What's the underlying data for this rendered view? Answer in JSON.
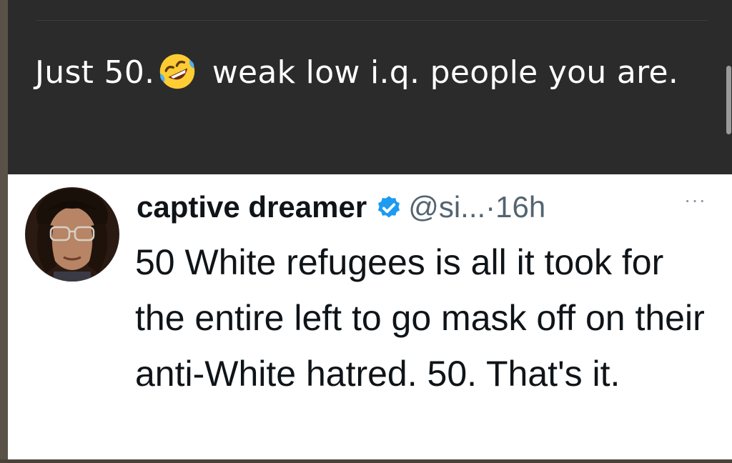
{
  "comment": {
    "text_before": "Just 50.",
    "emoji": "rolling-on-the-floor-laughing-emoji",
    "text_after": " weak low i.q. people you are."
  },
  "tweet": {
    "display_name": "captive dreamer",
    "verified_icon": "verified-badge-icon",
    "handle": "@si...",
    "separator": "·",
    "time": "16h",
    "more_label": "···",
    "body": "50 White refugees is all it took for the entire left to go mask off on their anti-White hatred.  50.  That's it."
  },
  "colors": {
    "dark_bg": "#2b2b2b",
    "verified_blue": "#1d9bf0",
    "text_dark": "#0f1419",
    "meta_gray": "#536471"
  }
}
